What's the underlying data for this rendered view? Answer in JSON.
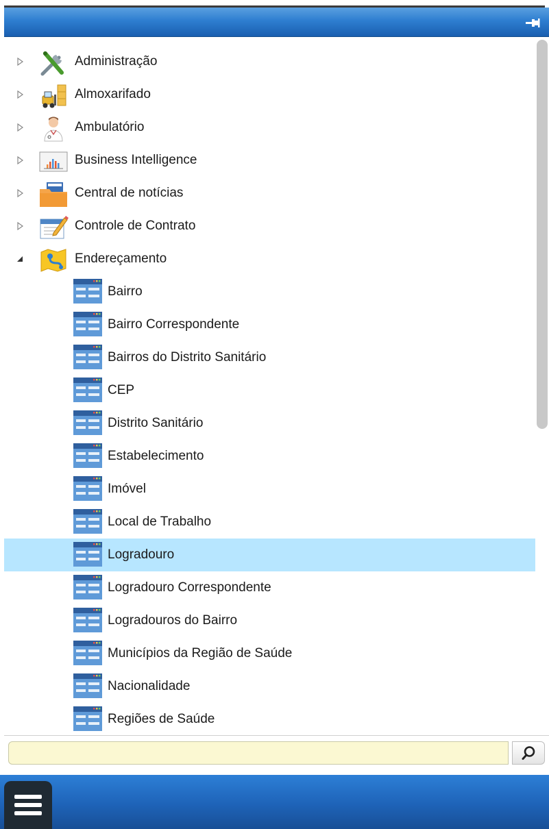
{
  "header": {
    "pin_icon": "pin-icon"
  },
  "tree": {
    "modules": [
      {
        "label": "Administração",
        "icon": "tools-icon",
        "expanded": false
      },
      {
        "label": "Almoxarifado",
        "icon": "forklift-icon",
        "expanded": false
      },
      {
        "label": "Ambulatório",
        "icon": "doctor-icon",
        "expanded": false
      },
      {
        "label": "Business Intelligence",
        "icon": "chart-icon",
        "expanded": false
      },
      {
        "label": "Central de notícias",
        "icon": "news-folder-icon",
        "expanded": false
      },
      {
        "label": "Controle de Contrato",
        "icon": "contract-pencil-icon",
        "expanded": false
      },
      {
        "label": "Endereçamento",
        "icon": "address-map-icon",
        "expanded": true
      }
    ],
    "children": [
      {
        "label": "Bairro",
        "selected": false
      },
      {
        "label": "Bairro Correspondente",
        "selected": false
      },
      {
        "label": "Bairros do Distrito Sanitário",
        "selected": false
      },
      {
        "label": "CEP",
        "selected": false
      },
      {
        "label": "Distrito Sanitário",
        "selected": false
      },
      {
        "label": "Estabelecimento",
        "selected": false
      },
      {
        "label": "Imóvel",
        "selected": false
      },
      {
        "label": "Local de Trabalho",
        "selected": false
      },
      {
        "label": "Logradouro",
        "selected": true
      },
      {
        "label": "Logradouro Correspondente",
        "selected": false
      },
      {
        "label": "Logradouros do Bairro",
        "selected": false
      },
      {
        "label": "Municípios da Região de Saúde",
        "selected": false
      },
      {
        "label": "Nacionalidade",
        "selected": false
      },
      {
        "label": "Regiões de Saúde",
        "selected": false
      }
    ]
  },
  "search": {
    "value": "",
    "placeholder": "",
    "icon": "search-icon"
  },
  "footer": {
    "menu_icon": "hamburger-menu-icon"
  },
  "colors": {
    "header": "#2e7ed0",
    "selected_row": "#b7e6ff",
    "search_field": "#fbf8d2",
    "footer": "#1e63b8"
  }
}
